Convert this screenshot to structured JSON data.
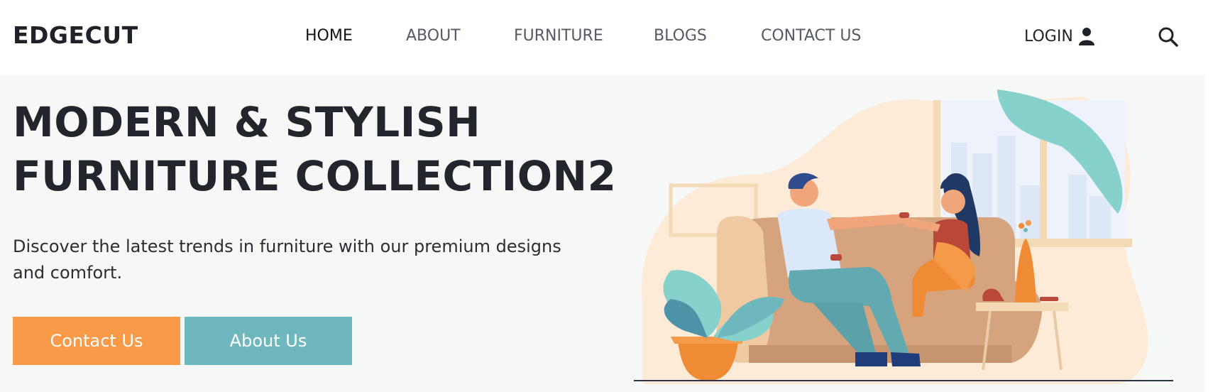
{
  "brand": "EDGECUT",
  "nav": {
    "home": "HOME",
    "about": "ABOUT",
    "furniture": "FURNITURE",
    "blogs": "BLOGS",
    "contact": "CONTACT US",
    "login": "LOGIN"
  },
  "icons": {
    "login": "user-icon",
    "search": "search-icon"
  },
  "hero": {
    "title_line1": "MODERN & STYLISH",
    "title_line2": "FURNITURE COLLECTION2",
    "description": "Discover the latest trends in furniture with our premium designs and comfort.",
    "primary_button": "Contact Us",
    "secondary_button": "About Us",
    "illustration": "couple-on-sofa-illustration"
  },
  "colors": {
    "accent_orange": "#f89a48",
    "accent_teal": "#6eb8bd",
    "hero_background": "#f6f8f7",
    "text_dark": "#22252b"
  }
}
